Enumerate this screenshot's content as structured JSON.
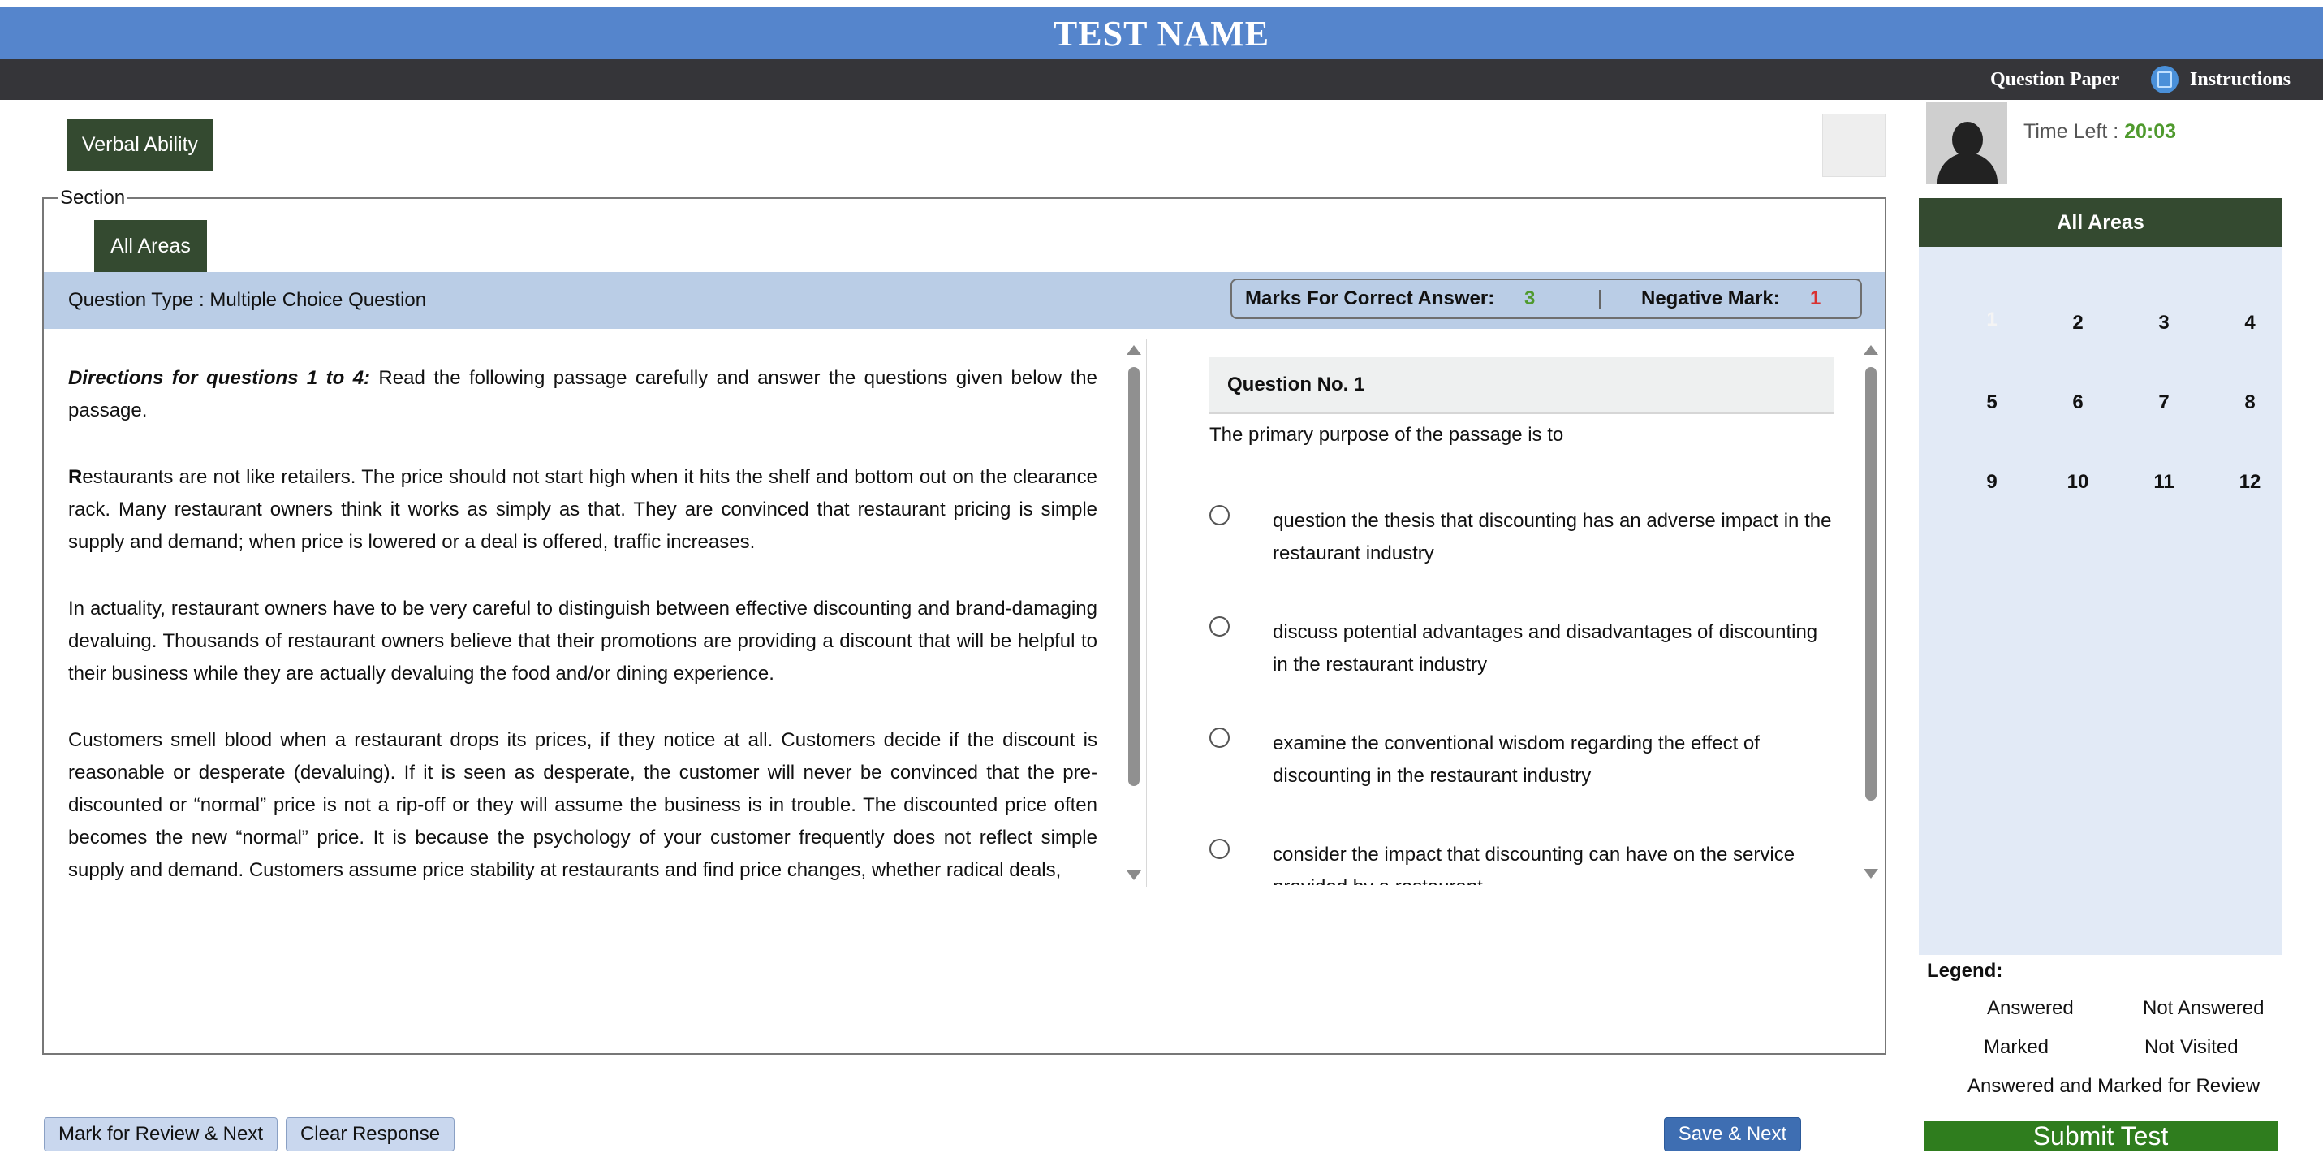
{
  "header": {
    "title": "TEST NAME",
    "nav": {
      "question_paper": "Question Paper",
      "instructions": "Instructions"
    }
  },
  "section_tab": "Verbal Ability",
  "candidate": {
    "time_label": "Time Left :",
    "time_value": "20:03"
  },
  "section": {
    "legend": "Section",
    "area_tab": "All Areas",
    "question_type": "Question Type : Multiple Choice Question",
    "marks_label": "Marks For Correct Answer:",
    "marks_value": "3",
    "negative_label": "Negative Mark:",
    "negative_value": "1"
  },
  "passage": {
    "directions_lead": "Directions for questions 1 to 4:",
    "directions_rest": " Read the following passage carefully and answer the questions given below the passage.",
    "p1_first": "R",
    "p1_rest": "estaurants are not like retailers. The price should not start high when it hits the shelf and bottom out on the clearance rack. Many restaurant owners think it works as simply as that. They are convinced that restaurant pricing is simple supply and demand; when price is lowered or a deal is offered, traffic increases.",
    "p2": "In actuality, restaurant owners have to be very careful to distinguish between effective discounting and brand-damaging devaluing. Thousands of restaurant owners believe that their promotions are providing a discount that will be helpful to their business while they are actually devaluing the food and/or dining experience.",
    "p3": "Customers smell blood when a restaurant drops its prices, if they notice at all. Customers decide if the discount is reasonable or desperate (devaluing). If it is seen as desperate, the customer will never be convinced that the pre-discounted or “normal” price is not a rip-off or they will assume the business is in trouble. The discounted price often becomes the new “normal” price. It is because the psychology of your customer frequently does not reflect simple supply and demand. Customers assume price stability at restaurants and find price changes, whether radical deals,"
  },
  "question": {
    "number_label": "Question No. 1",
    "text": "The primary purpose of the passage is to",
    "options": [
      "question the thesis that discounting has an adverse impact in the restaurant industry",
      "discuss potential advantages and disadvantages of discounting in the restaurant industry",
      "examine the conventional wisdom regarding the effect of discounting in the restaurant industry",
      "consider the impact that discounting can have on the service provided by a restaurant"
    ]
  },
  "palette": {
    "header": "All Areas",
    "questions": [
      "1",
      "2",
      "3",
      "4",
      "5",
      "6",
      "7",
      "8",
      "9",
      "10",
      "11",
      "12"
    ],
    "current": "1"
  },
  "legend": {
    "title": "Legend:",
    "answered": "Answered",
    "not_answered": "Not Answered",
    "marked": "Marked",
    "not_visited": "Not Visited",
    "answered_marked": "Answered and Marked for Review"
  },
  "buttons": {
    "submit": "Submit Test",
    "mark_review": "Mark for Review & Next",
    "clear": "Clear Response",
    "save_next": "Save & Next"
  },
  "colors": {
    "header_blue": "#5585cc",
    "nav_dark": "#353539",
    "tab_dark_green": "#344a30",
    "submit_green": "#2f7d1e",
    "marks_green": "#4f9a2e",
    "negative_red": "#d93030"
  }
}
